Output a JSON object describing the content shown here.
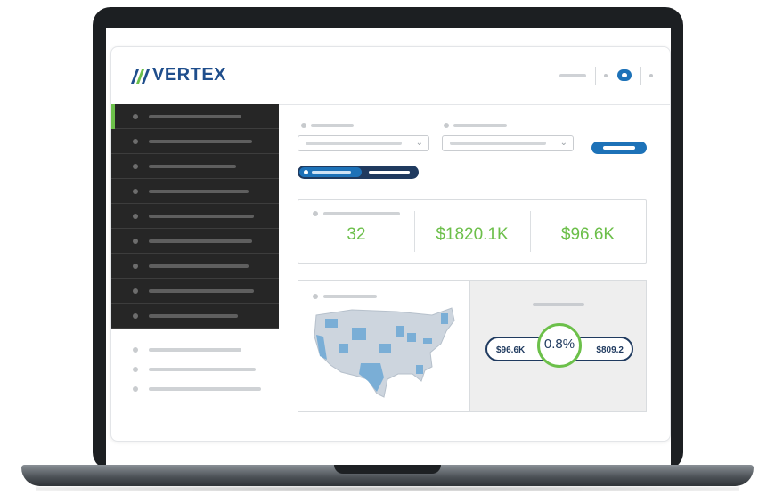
{
  "app": {
    "brand": "VERTEX"
  },
  "sidebar": {
    "items": [
      {
        "id": "nav-1",
        "active": true
      },
      {
        "id": "nav-2"
      },
      {
        "id": "nav-3"
      },
      {
        "id": "nav-4"
      },
      {
        "id": "nav-5"
      },
      {
        "id": "nav-6"
      },
      {
        "id": "nav-7"
      },
      {
        "id": "nav-8"
      },
      {
        "id": "nav-9"
      }
    ],
    "sub_items": [
      {
        "id": "sub-1"
      },
      {
        "id": "sub-2"
      },
      {
        "id": "sub-3"
      }
    ]
  },
  "kpis": {
    "count": "32",
    "total": "$1820.1K",
    "tax": "$96.6K"
  },
  "ratio": {
    "left_value": "$96.6K",
    "center_value": "0.8%",
    "right_value": "$809.2"
  },
  "colors": {
    "accent_blue": "#1d72b8",
    "navy": "#1f3a5f",
    "green": "#6cc04a",
    "sidebar_bg": "#262626",
    "map_states": "#cdd5de",
    "map_highlight": "#7aaed6"
  },
  "icons": {
    "chevron": "chevron-down-icon",
    "logo": "vertex-logo-icon"
  }
}
